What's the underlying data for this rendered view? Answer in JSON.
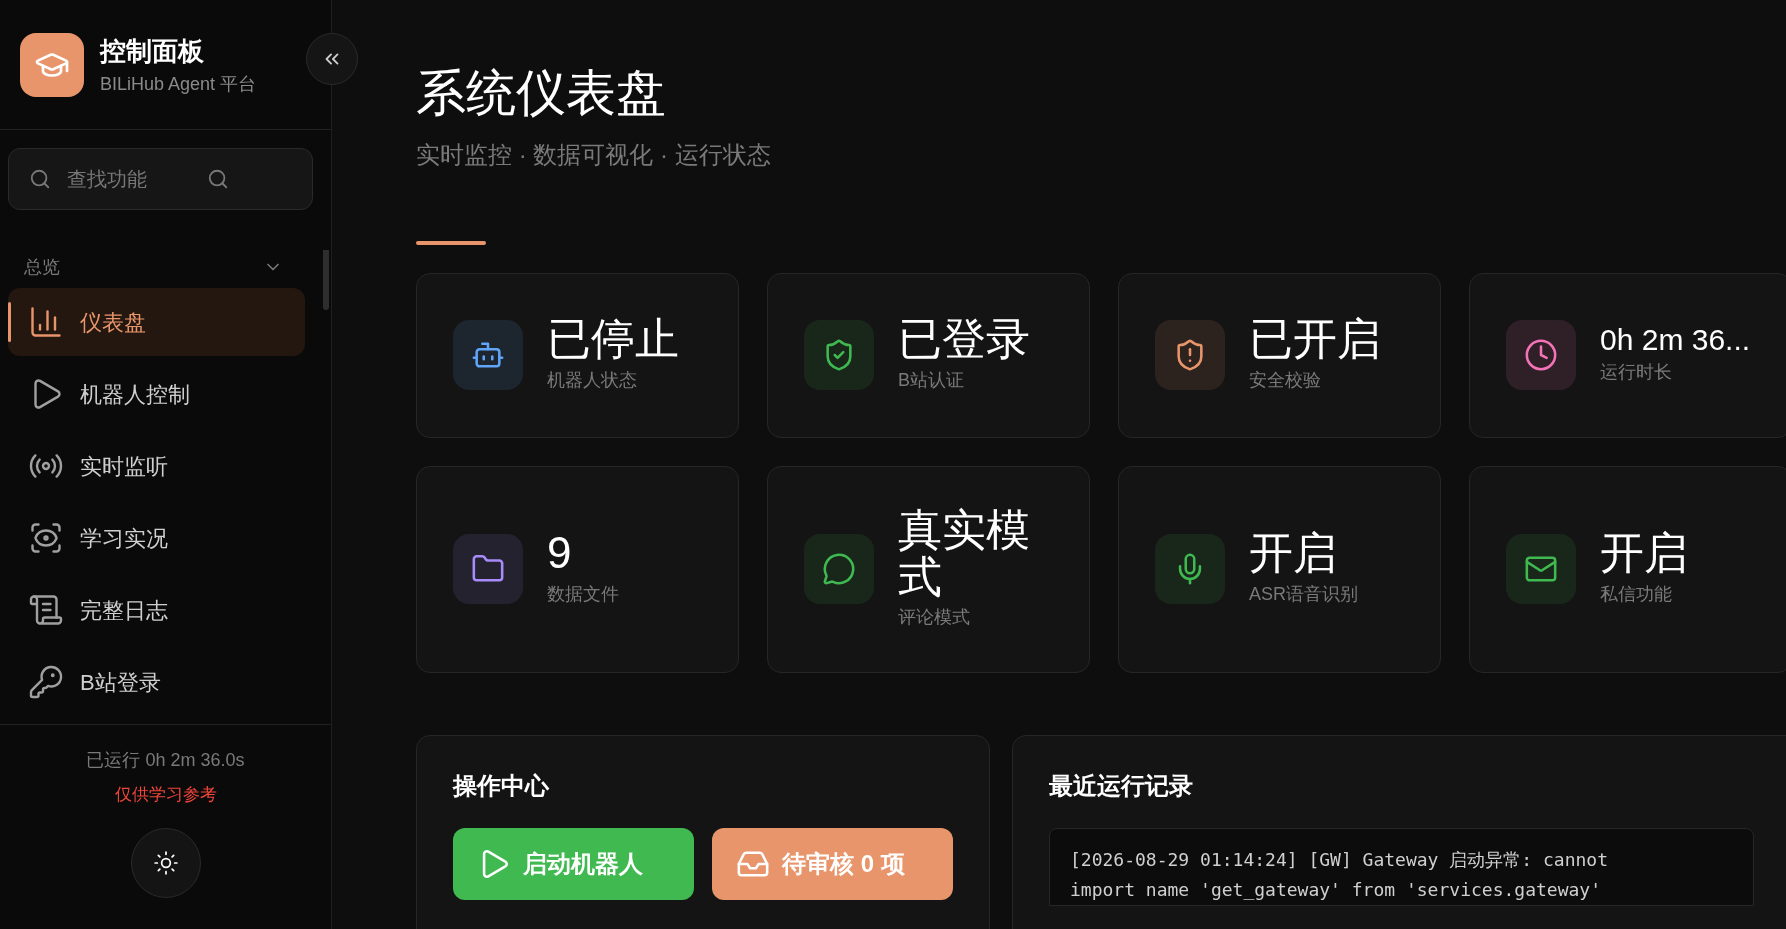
{
  "sidebar": {
    "app_title": "控制面板",
    "app_subtitle": "BILiHub Agent 平台",
    "search": {
      "placeholder": "查找功能"
    },
    "section": {
      "label": "总览",
      "expanded": true
    },
    "items": [
      {
        "label": "仪表盘",
        "selected": true
      },
      {
        "label": "机器人控制",
        "selected": false
      },
      {
        "label": "实时监听",
        "selected": false
      },
      {
        "label": "学习实况",
        "selected": false
      },
      {
        "label": "完整日志",
        "selected": false
      },
      {
        "label": "B站登录",
        "selected": false
      }
    ],
    "uptime": "已运行 0h 2m 36.0s",
    "notice": "仅供学习参考"
  },
  "page": {
    "title": "系统仪表盘",
    "subtitle": "实时监控 · 数据可视化 · 运行状态"
  },
  "cards": [
    {
      "value": "已停止",
      "label": "机器人状态",
      "color": "#60a5fa"
    },
    {
      "value": "已登录",
      "label": "B站认证",
      "color": "#3fb950"
    },
    {
      "value": "已开启",
      "label": "安全校验",
      "color": "#e8956b"
    },
    {
      "value": "0h 2m 36...",
      "label": "运行时长",
      "color": "#f472b6"
    },
    {
      "value": "9",
      "label": "数据文件",
      "color": "#a78bfa"
    },
    {
      "value": "真实模式",
      "label": "评论模式",
      "color": "#3fb950"
    },
    {
      "value": "开启",
      "label": "ASR语音识别",
      "color": "#3fb950"
    },
    {
      "value": "开启",
      "label": "私信功能",
      "color": "#3fb950"
    }
  ],
  "actions": {
    "title": "操作中心",
    "buttons": [
      {
        "label": "启动机器人",
        "kind": "start"
      },
      {
        "label": "待审核 0 项",
        "kind": "review"
      }
    ]
  },
  "log": {
    "title": "最近运行记录",
    "lines": [
      "[2026-08-29 01:14:24] [GW] Gateway 启动异常: cannot",
      "import name 'get_gateway' from 'services.gateway'"
    ]
  }
}
